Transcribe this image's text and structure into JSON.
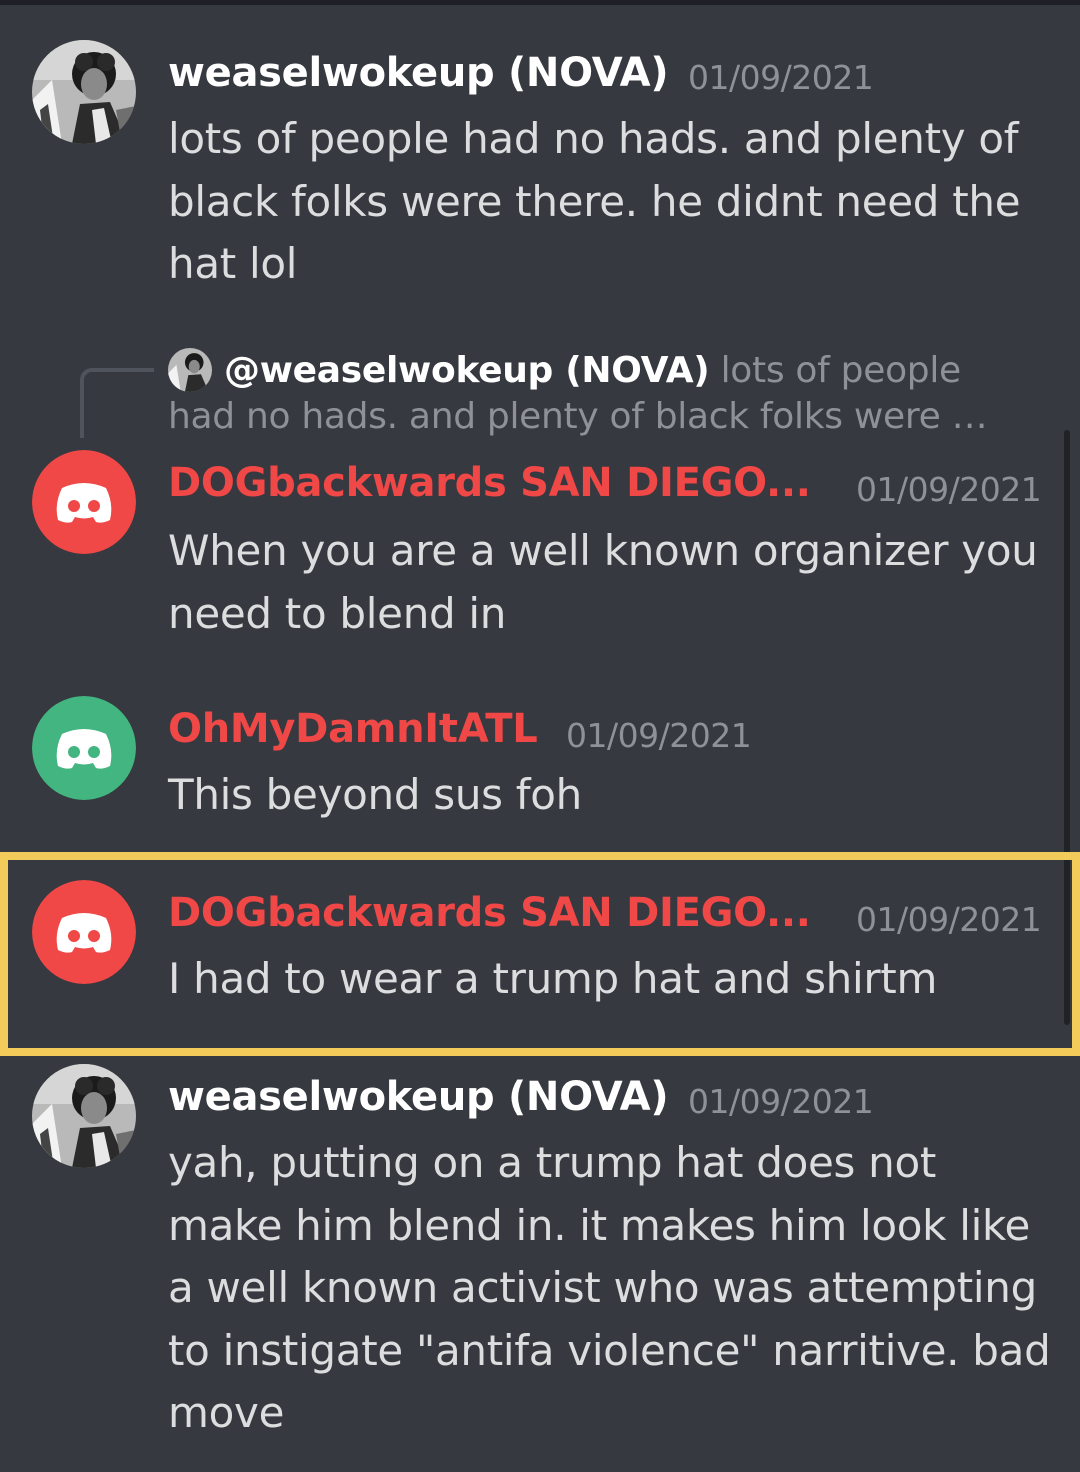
{
  "messages": [
    {
      "author": "weaselwokeup (NOVA)",
      "timestamp": "01/09/2021",
      "text": "lots of people had no hads. and plenty of black folks were there. he didnt need the hat lol",
      "avatar": "photo-avatar"
    },
    {
      "reply_to": {
        "author": "@weaselwokeup (NOVA)",
        "text": "lots of people had no hads. and plenty of black folks were …"
      },
      "author": "DOGbackwards SAN DIEGO...",
      "timestamp": "01/09/2021",
      "text": "When you are a well known organizer you need to blend in",
      "avatar": "discord-icon",
      "avatar_color": "#f04747"
    },
    {
      "author": "OhMyDamnItATL",
      "timestamp": "01/09/2021",
      "text": "This beyond sus foh",
      "avatar": "discord-icon",
      "avatar_color": "#43b581"
    },
    {
      "author": "DOGbackwards SAN DIEGO...",
      "timestamp": "01/09/2021",
      "text": "I had to wear a trump hat and shirtm",
      "avatar": "discord-icon",
      "avatar_color": "#f04747",
      "highlighted": true
    },
    {
      "author": "weaselwokeup (NOVA)",
      "timestamp": "01/09/2021",
      "text": "yah, putting on a trump hat does not make him blend in. it makes him look like a well known activist who was attempting to instigate \"antifa violence\" narritive. bad move",
      "avatar": "photo-avatar"
    }
  ],
  "colors": {
    "background": "#36393f",
    "author_red": "#f04747",
    "author_white": "#ffffff",
    "timestamp": "#8e9297",
    "highlight_border": "#f2cb5a"
  }
}
